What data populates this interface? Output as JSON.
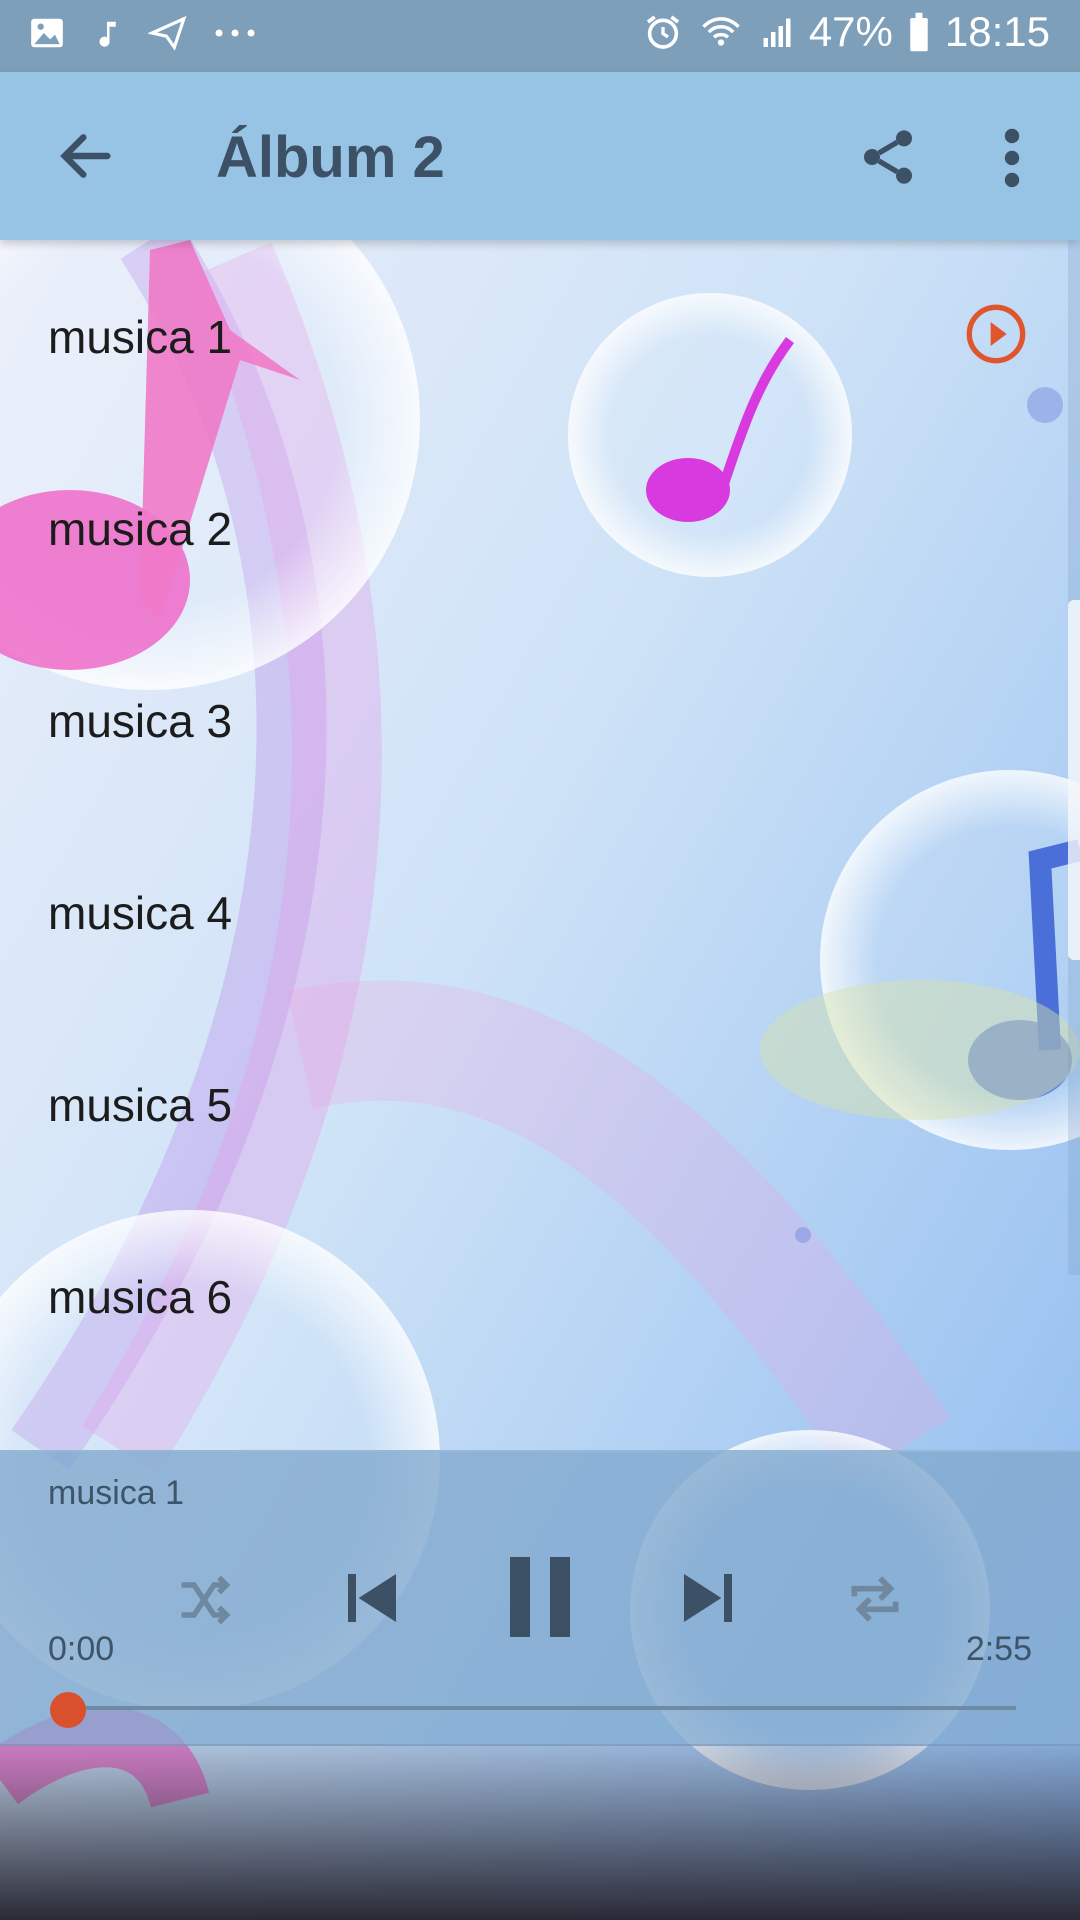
{
  "status_bar": {
    "battery": "47%",
    "time": "18:15",
    "icons": [
      "image-icon",
      "music-note-icon",
      "send-icon",
      "more-dots-icon",
      "alarm-icon",
      "wifi-icon",
      "signal-icon",
      "battery-icon"
    ]
  },
  "app_bar": {
    "title": "Álbum 2",
    "icons": [
      "back-arrow-icon",
      "share-icon",
      "more-vertical-icon"
    ]
  },
  "tracks": [
    {
      "label": "musica 1",
      "playing": true
    },
    {
      "label": "musica 2"
    },
    {
      "label": "musica 3"
    },
    {
      "label": "musica 4"
    },
    {
      "label": "musica 5"
    },
    {
      "label": "musica 6"
    }
  ],
  "player": {
    "now_playing": "musica 1",
    "elapsed": "0:00",
    "duration": "2:55",
    "progress": 0.0,
    "accent_color": "#d9502d",
    "controls": [
      "shuffle-icon",
      "previous-icon",
      "pause-icon",
      "next-icon",
      "repeat-icon"
    ]
  }
}
